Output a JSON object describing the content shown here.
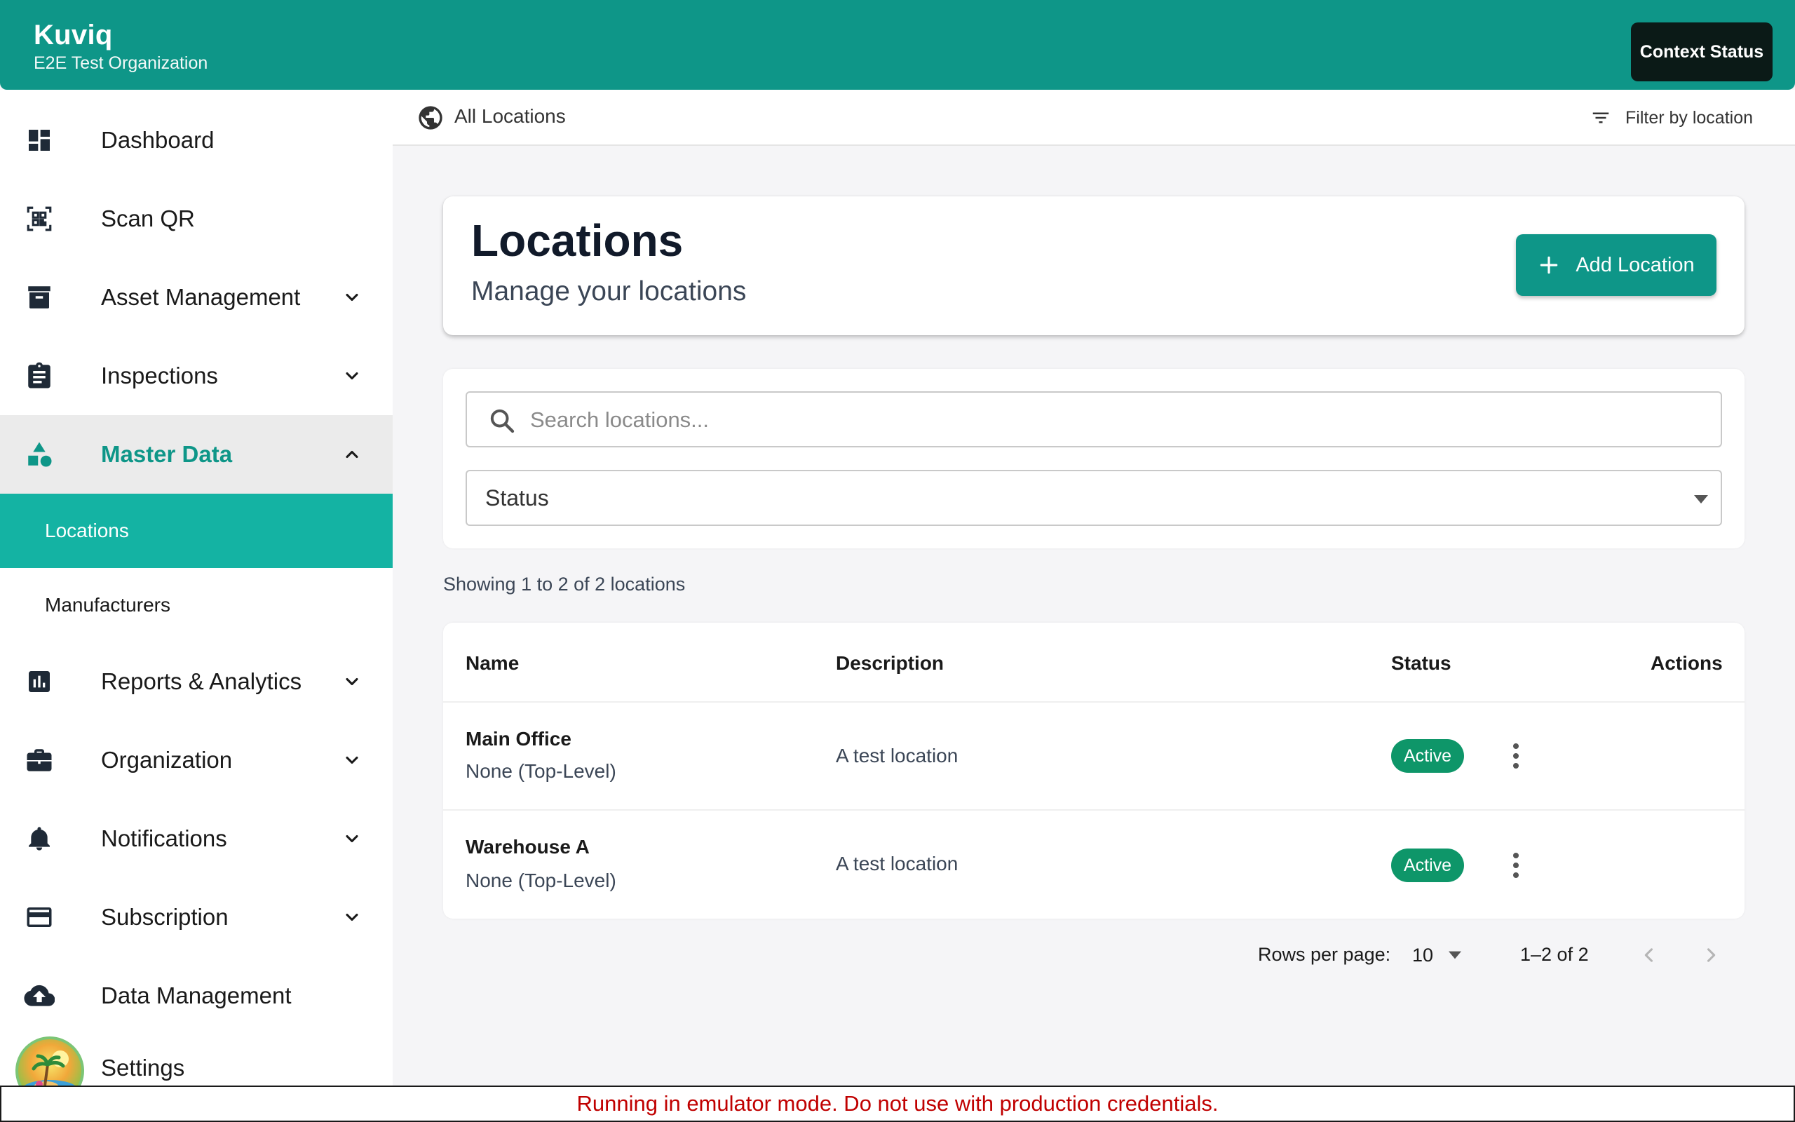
{
  "header": {
    "app_name": "Kuviq",
    "org_name": "E2E Test Organization",
    "context_button": "Context Status",
    "brand_color": "#0e9688"
  },
  "sidebar": {
    "items": [
      {
        "label": "Dashboard",
        "icon": "dashboard-icon"
      },
      {
        "label": "Scan QR",
        "icon": "qr-scan-icon"
      },
      {
        "label": "Asset Management",
        "icon": "archive-icon",
        "expandable": true
      },
      {
        "label": "Inspections",
        "icon": "clipboard-icon",
        "expandable": true
      },
      {
        "label": "Master Data",
        "icon": "category-icon",
        "expandable": true,
        "expanded": true
      },
      {
        "label": "Reports & Analytics",
        "icon": "bar-chart-icon",
        "expandable": true
      },
      {
        "label": "Organization",
        "icon": "briefcase-icon",
        "expandable": true
      },
      {
        "label": "Notifications",
        "icon": "bell-icon",
        "expandable": true
      },
      {
        "label": "Subscription",
        "icon": "credit-card-icon",
        "expandable": true
      },
      {
        "label": "Data Management",
        "icon": "cloud-upload-icon"
      },
      {
        "label": "Settings",
        "icon": "settings-icon"
      }
    ],
    "master_data_children": [
      {
        "label": "Locations",
        "active": true
      },
      {
        "label": "Manufacturers"
      }
    ],
    "active_color": "#14b3a3"
  },
  "location_bar": {
    "current": "All Locations",
    "filter_label": "Filter by location"
  },
  "page": {
    "title": "Locations",
    "subtitle": "Manage your locations",
    "add_button": "Add Location"
  },
  "filters": {
    "search_placeholder": "Search locations...",
    "status_label": "Status"
  },
  "table": {
    "summary": "Showing 1 to 2 of 2 locations",
    "columns": [
      "Name",
      "Description",
      "Status",
      "Actions"
    ],
    "rows": [
      {
        "name": "Main Office",
        "parent": "None (Top-Level)",
        "description": "A test location",
        "status": "Active"
      },
      {
        "name": "Warehouse A",
        "parent": "None (Top-Level)",
        "description": "A test location",
        "status": "Active"
      }
    ],
    "status_color": "#0e9669"
  },
  "pagination": {
    "rows_per_page_label": "Rows per page:",
    "rows_per_page": "10",
    "range": "1–2 of 2"
  },
  "banner": {
    "text": "Running in emulator mode. Do not use with production credentials.",
    "color": "#c00000"
  }
}
